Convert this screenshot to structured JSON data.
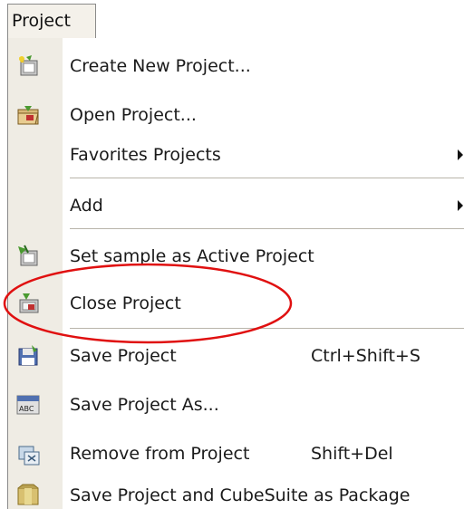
{
  "menubar": {
    "tab_label": "Project"
  },
  "menu": {
    "items": [
      {
        "label": "Create New Project...",
        "shortcut": "",
        "submenu": false,
        "icon": "create-project-icon"
      },
      {
        "label": "Open Project...",
        "shortcut": "",
        "submenu": false,
        "icon": "open-project-icon"
      },
      {
        "label": "Favorites Projects",
        "shortcut": "",
        "submenu": true,
        "icon": ""
      },
      {
        "label": "Add",
        "shortcut": "",
        "submenu": true,
        "icon": ""
      },
      {
        "label": "Set sample as Active Project",
        "shortcut": "",
        "submenu": false,
        "icon": "set-active-project-icon"
      },
      {
        "label": "Close Project",
        "shortcut": "",
        "submenu": false,
        "icon": "close-project-icon"
      },
      {
        "label": "Save Project",
        "shortcut": "Ctrl+Shift+S",
        "submenu": false,
        "icon": "save-project-icon"
      },
      {
        "label": "Save Project As...",
        "shortcut": "",
        "submenu": false,
        "icon": "save-project-as-icon"
      },
      {
        "label": "Remove from Project",
        "shortcut": "Shift+Del",
        "submenu": false,
        "icon": "remove-from-project-icon"
      },
      {
        "label": "Save Project and CubeSuite as Package",
        "shortcut": "",
        "submenu": false,
        "icon": "save-package-icon"
      }
    ]
  },
  "annotation": {
    "highlight_color": "#e01010",
    "highlighted_item": "Close Project"
  }
}
